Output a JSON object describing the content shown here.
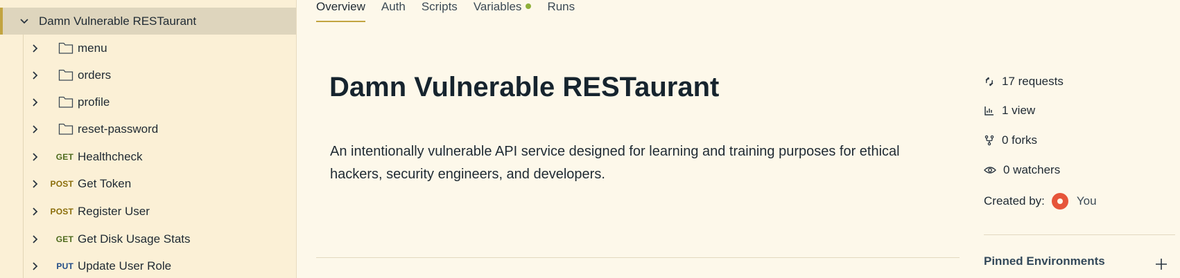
{
  "sidebar": {
    "collection": {
      "name": "Damn Vulnerable RESTaurant"
    },
    "folders": [
      {
        "name": "menu"
      },
      {
        "name": "orders"
      },
      {
        "name": "profile"
      },
      {
        "name": "reset-password"
      }
    ],
    "requests": [
      {
        "method": "GET",
        "name": "Healthcheck"
      },
      {
        "method": "POST",
        "name": "Get Token"
      },
      {
        "method": "POST",
        "name": "Register User"
      },
      {
        "method": "GET",
        "name": "Get Disk Usage Stats"
      },
      {
        "method": "PUT",
        "name": "Update User Role"
      }
    ]
  },
  "tabs": [
    {
      "label": "Overview"
    },
    {
      "label": "Auth"
    },
    {
      "label": "Scripts"
    },
    {
      "label": "Variables"
    },
    {
      "label": "Runs"
    }
  ],
  "overview": {
    "title": "Damn Vulnerable RESTaurant",
    "description": "An intentionally vulnerable API service designed for learning and training purposes for ethical hackers, security engineers, and developers."
  },
  "meta": {
    "requests": "17 requests",
    "views": "1 view",
    "forks": "0 forks",
    "watchers": "0 watchers",
    "created_by_label": "Created by:",
    "created_by_user": "You",
    "pinned_environments": "Pinned Environments"
  },
  "colors": {
    "accent": "#c2a441",
    "variables_dot": "#8fb03a",
    "get": "#4d6a1c",
    "post": "#8a6d0a",
    "put": "#214c87"
  }
}
